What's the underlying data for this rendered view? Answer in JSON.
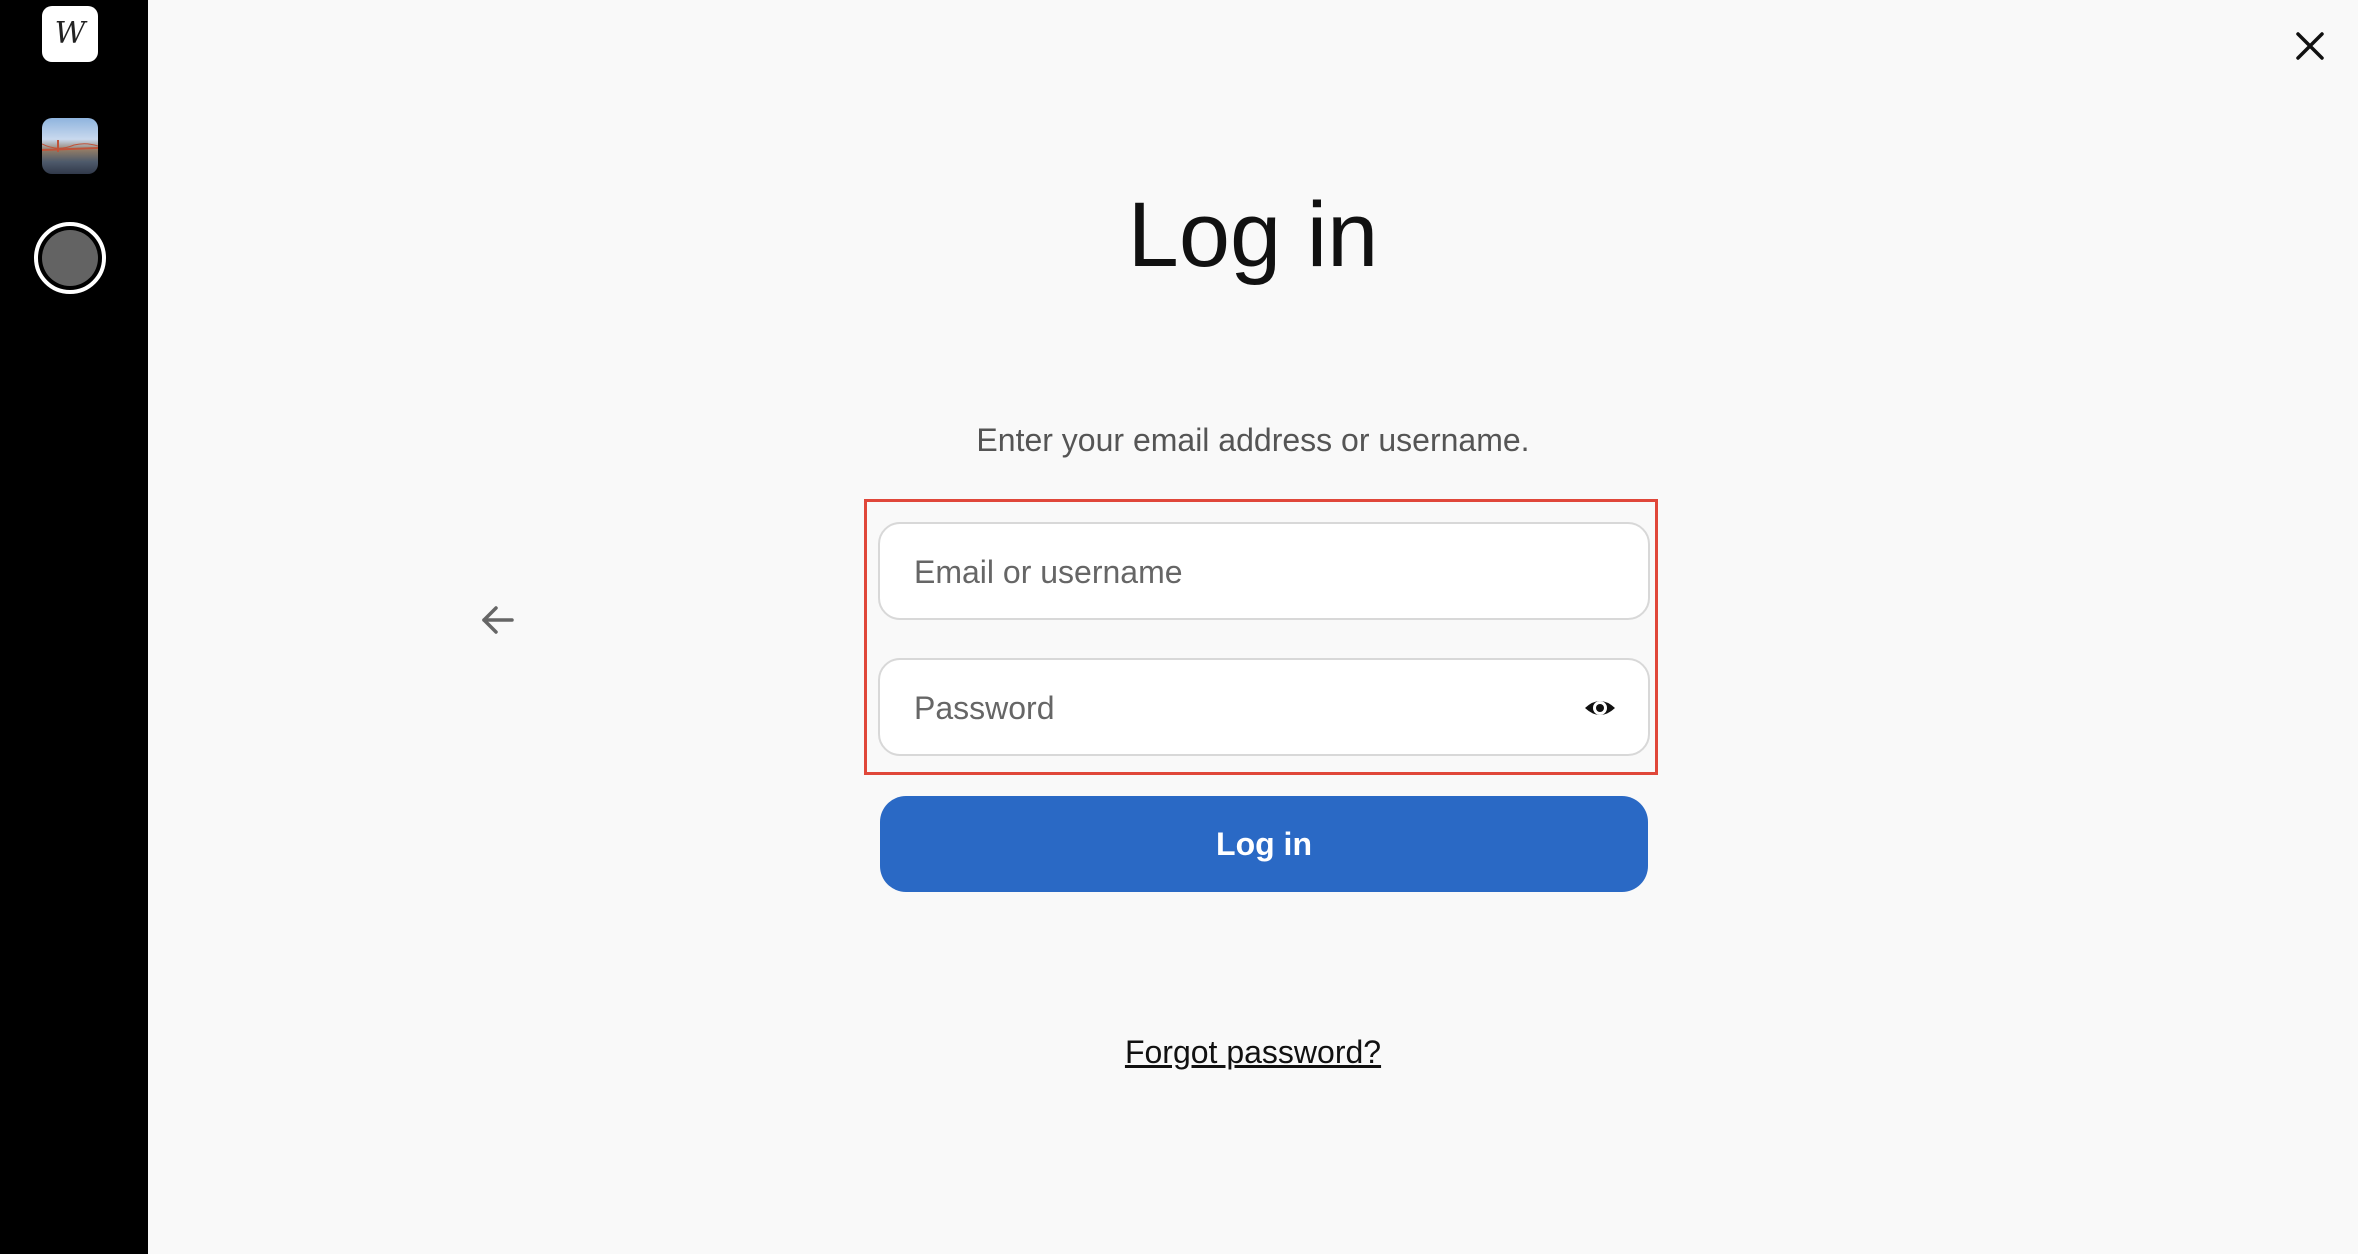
{
  "sidebar": {
    "apps": [
      {
        "name": "wix-logo",
        "glyph": "W"
      },
      {
        "name": "photo-thumbnail"
      },
      {
        "name": "record-button"
      }
    ]
  },
  "header": {
    "close_icon": "close-icon"
  },
  "main": {
    "title": "Log in",
    "subtitle": "Enter your email address or username.",
    "email_placeholder": "Email or username",
    "email_value": "",
    "password_placeholder": "Password",
    "password_value": "",
    "password_toggle_icon": "eye-icon",
    "back_icon": "arrow-left-icon",
    "login_button_label": "Log in",
    "forgot_password_label": "Forgot password?"
  },
  "colors": {
    "primary": "#2a69c5",
    "sidebar_bg": "#000000",
    "page_bg": "#f9f9f9",
    "highlight": "#e0473a"
  }
}
